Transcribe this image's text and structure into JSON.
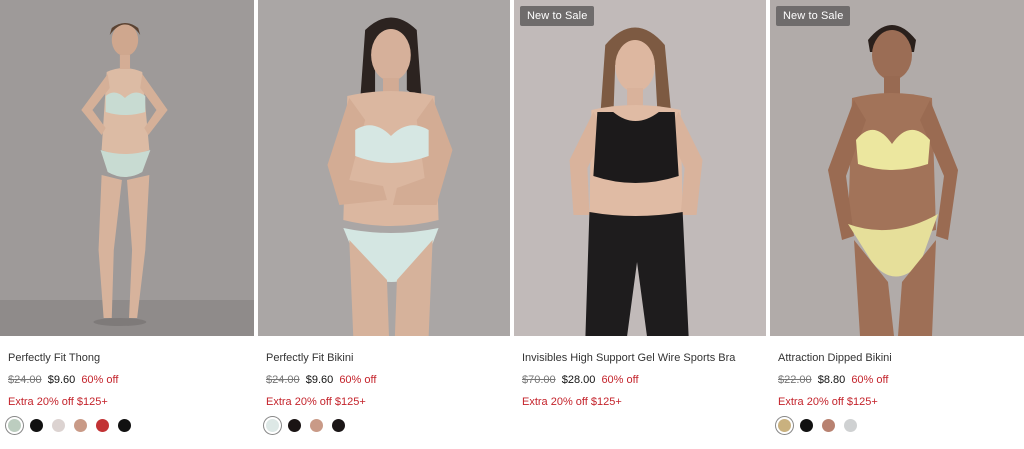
{
  "products": [
    {
      "name": "Perfectly Fit Thong",
      "badge": "",
      "original_price": "$24.00",
      "sale_price": "$9.60",
      "discount": "60% off",
      "promo": "Extra 20% off $125+",
      "image_bg": "#9d9999",
      "swatches": [
        "#bccdbf",
        "#111111",
        "#dcd3d1",
        "#c99a87",
        "#c23234",
        "#111111"
      ]
    },
    {
      "name": "Perfectly Fit Bikini",
      "badge": "",
      "original_price": "$24.00",
      "sale_price": "$9.60",
      "discount": "60% off",
      "promo": "Extra 20% off $125+",
      "image_bg": "#a9a5a4",
      "swatches": [
        "#dde8e6",
        "#1a1414",
        "#c99a87",
        "#1b1617"
      ]
    },
    {
      "name": "Invisibles High Support Gel Wire Sports Bra",
      "badge": "New to Sale",
      "original_price": "$70.00",
      "sale_price": "$28.00",
      "discount": "60% off",
      "promo": "Extra 20% off $125+",
      "image_bg": "#bfb8b8",
      "swatches": []
    },
    {
      "name": "Attraction Dipped Bikini",
      "badge": "New to Sale",
      "original_price": "$22.00",
      "sale_price": "$8.80",
      "discount": "60% off",
      "promo": "Extra 20% off $125+",
      "image_bg": "#b0aaa8",
      "swatches": [
        "#c9b17f",
        "#111111",
        "#b88271",
        "#cfd1d2"
      ]
    }
  ]
}
